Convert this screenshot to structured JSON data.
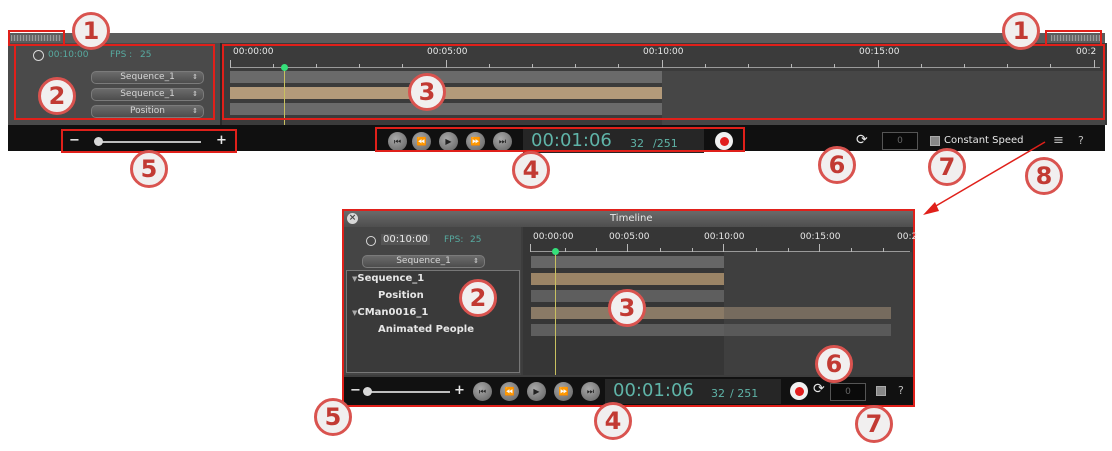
{
  "callouts": [
    "1",
    "1",
    "2",
    "3",
    "4",
    "5",
    "6",
    "7",
    "8",
    "2",
    "3",
    "4",
    "5",
    "6",
    "7"
  ],
  "top_panel": {
    "duration": "00:10:00",
    "fps_label": "FPS :",
    "fps_value": "25",
    "dropdowns": [
      "Sequence_1",
      "Sequence_1",
      "Position"
    ],
    "ruler": [
      "00:00:00",
      "00:05:00",
      "00:10:00",
      "00:15:00",
      "00:2"
    ],
    "zoom_minus": "−",
    "zoom_plus": "+",
    "timecode": "00:01:06",
    "frame_current": "32",
    "frame_total": "/251",
    "loop_value": "0",
    "constant_speed": "Constant Speed",
    "menu_icon": "≡",
    "help": "?"
  },
  "timeline_window": {
    "title": "Timeline",
    "duration": "00:10:00",
    "fps_label": "FPS:",
    "fps_value": "25",
    "dropdown": "Sequence_1",
    "tree": [
      "Sequence_1",
      "Position",
      "CMan0016_1",
      "Animated People"
    ],
    "ruler": [
      "00:00:00",
      "00:05:00",
      "00:10:00",
      "00:15:00",
      "00:2"
    ],
    "zoom_minus": "−",
    "zoom_plus": "+",
    "timecode": "00:01:06",
    "frame_current": "32",
    "frame_total": "/ 251",
    "loop_value": "0",
    "help": "?"
  },
  "colors": {
    "callout_border": "#d9534f",
    "highlight": "#e0201a",
    "keyframe_track": "#b39a7a",
    "timecode": "#5fb4a8"
  }
}
